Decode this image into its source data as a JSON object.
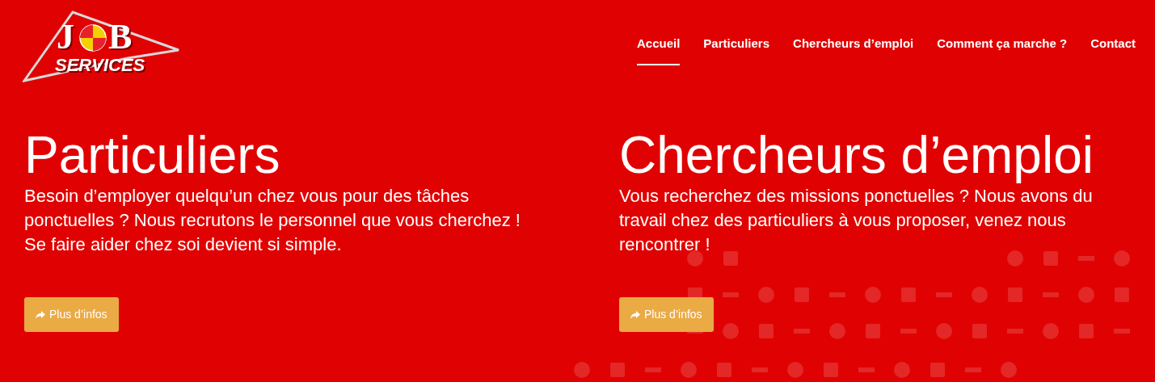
{
  "logo": {
    "letters": [
      "J",
      "B"
    ],
    "subtitle": "SERVICES"
  },
  "nav": [
    {
      "label": "Accueil",
      "selected": true
    },
    {
      "label": "Particuliers",
      "selected": false
    },
    {
      "label": "Chercheurs d’emploi",
      "selected": false
    },
    {
      "label": "Comment ça marche ?",
      "selected": false
    },
    {
      "label": "Contact",
      "selected": false
    }
  ],
  "sections": [
    {
      "title": "Particuliers",
      "text": "Besoin d’employer quelqu’un chez vous pour des tâches ponctuelles ? Nous recrutons le personnel que vous cherchez ! Se faire aider chez soi devient si simple.",
      "button": "Plus d’infos"
    },
    {
      "title": "Chercheurs d’emploi",
      "text": "Vous recherchez des missions ponctuelles ? Nous avons du travail chez des particuliers à vous proposer, venez nous rencontrer !",
      "button": "Plus d’infos"
    }
  ]
}
